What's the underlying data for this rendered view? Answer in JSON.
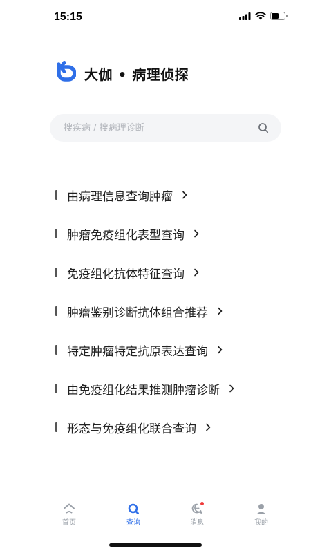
{
  "status_bar": {
    "time": "15:15"
  },
  "header": {
    "title": "大伽 • 病理侦探",
    "logo_icon": "undo-arrow-logo",
    "brand_color": "#2f6fe8"
  },
  "search": {
    "placeholder": "搜疾病 / 搜病理诊断",
    "value": "",
    "icon": "search-icon"
  },
  "menu": {
    "items": [
      {
        "label": "由病理信息查询肿瘤"
      },
      {
        "label": "肿瘤免疫组化表型查询"
      },
      {
        "label": "免疫组化抗体特征查询"
      },
      {
        "label": "肿瘤鉴别诊断抗体组合推荐"
      },
      {
        "label": "特定肿瘤特定抗原表达查询"
      },
      {
        "label": "由免疫组化结果推测肿瘤诊断"
      },
      {
        "label": "形态与免疫组化联合查询"
      }
    ]
  },
  "tab_bar": {
    "active": "查询",
    "tabs": [
      {
        "label": "首页",
        "icon": "home-icon"
      },
      {
        "label": "查询",
        "icon": "query-icon"
      },
      {
        "label": "消息",
        "icon": "message-icon",
        "badge": "unread-dot"
      },
      {
        "label": "我的",
        "icon": "profile-icon"
      }
    ]
  },
  "colors": {
    "accent": "#2f6fe8",
    "inactive": "#9aa0a8",
    "badge": "#ef3b3b",
    "search_bg": "#f4f5f7"
  }
}
